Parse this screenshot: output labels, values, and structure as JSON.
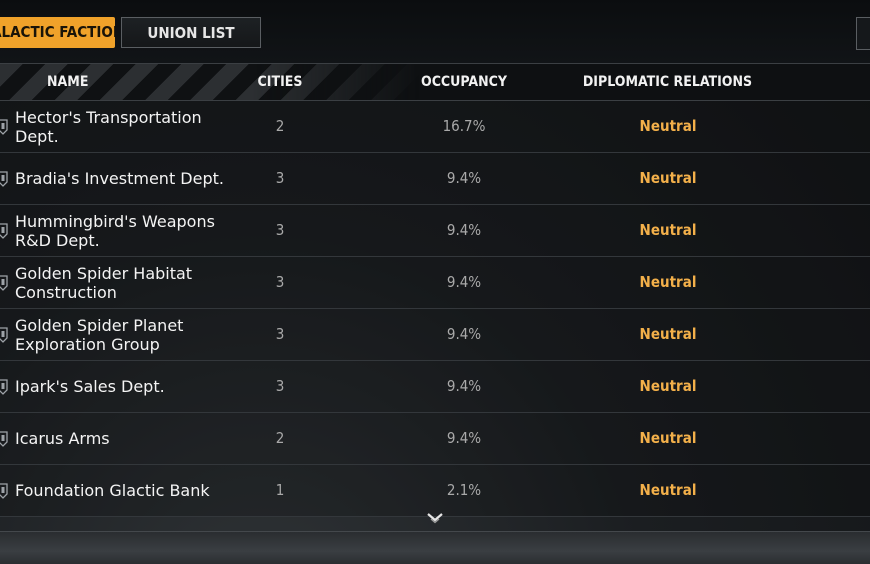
{
  "tabs": [
    {
      "label": "GALACTIC FACTION",
      "active": true
    },
    {
      "label": "UNION LIST",
      "active": false
    }
  ],
  "columns": {
    "name": "NAME",
    "cities": "CITIES",
    "occupancy": "OCCUPANCY",
    "relations": "DIPLOMATIC RELATIONS"
  },
  "rows": [
    {
      "name": "Hector's Transportation Dept.",
      "cities": "2",
      "occupancy": "16.7%",
      "relation": "Neutral"
    },
    {
      "name": "Bradia's Investment Dept.",
      "cities": "3",
      "occupancy": "9.4%",
      "relation": "Neutral"
    },
    {
      "name": "Hummingbird's Weapons R&D Dept.",
      "cities": "3",
      "occupancy": "9.4%",
      "relation": "Neutral"
    },
    {
      "name": "Golden Spider Habitat Construction",
      "cities": "3",
      "occupancy": "9.4%",
      "relation": "Neutral"
    },
    {
      "name": "Golden Spider Planet Exploration Group",
      "cities": "3",
      "occupancy": "9.4%",
      "relation": "Neutral"
    },
    {
      "name": "Ipark's Sales Dept.",
      "cities": "3",
      "occupancy": "9.4%",
      "relation": "Neutral"
    },
    {
      "name": "Icarus Arms",
      "cities": "2",
      "occupancy": "9.4%",
      "relation": "Neutral"
    },
    {
      "name": "Foundation Glactic Bank",
      "cities": "1",
      "occupancy": "2.1%",
      "relation": "Neutral"
    }
  ],
  "icons": {
    "row_icon": "faction-emblem-icon",
    "scroll": "chevron-down-icon"
  },
  "colors": {
    "accent": "#f0a22a",
    "relation_neutral": "#f3b04a"
  }
}
